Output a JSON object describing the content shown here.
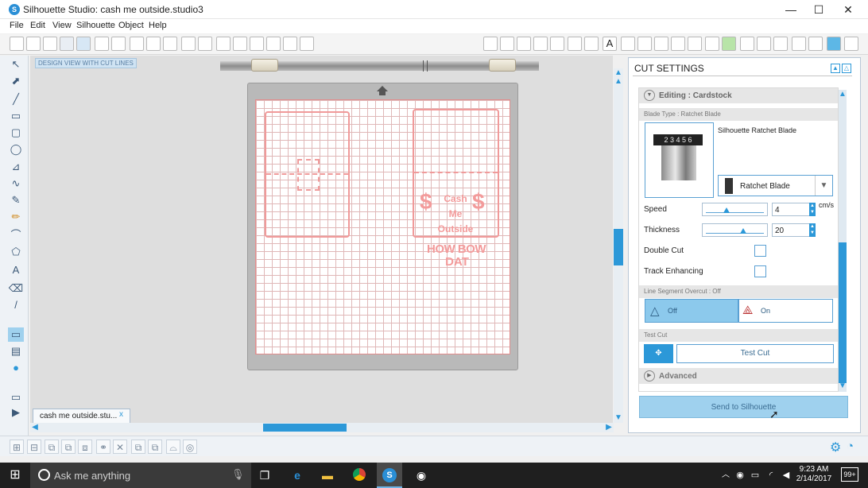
{
  "window": {
    "title": "Silhouette Studio: cash me outside.studio3",
    "app_icon": "S",
    "minimize": "—",
    "maximize": "☐",
    "close": "✕"
  },
  "menu": [
    "File",
    "Edit",
    "View",
    "Silhouette",
    "Object",
    "Help"
  ],
  "design": {
    "view_label": "DESIGN VIEW WITH CUT LINES",
    "artwork_text": {
      "line1": "Cash",
      "line2": "Me",
      "line3": "Outside",
      "dollar": "$",
      "how_bow": "HOW BOW",
      "dat": "DAT"
    },
    "doc_tab": "cash me outside.stu...",
    "doc_tab_close": "x"
  },
  "cut_settings": {
    "title": "CUT SETTINGS",
    "editing": "Editing : Cardstock",
    "blade_type_header": "Blade Type : Ratchet Blade",
    "blade_name": "Silhouette Ratchet Blade",
    "blade_select": "Ratchet Blade",
    "blade_dial_text": "2 3 4 5 6",
    "speed_label": "Speed",
    "speed_value": "4",
    "speed_unit": "cm/s",
    "thickness_label": "Thickness",
    "thickness_value": "20",
    "double_cut_label": "Double Cut",
    "track_enhancing_label": "Track Enhancing",
    "line_overcut_header": "Line Segment Overcut : Off",
    "off_label": "Off",
    "on_label": "On",
    "test_cut_header": "Test Cut",
    "test_cut_button": "Test Cut",
    "advanced_label": "Advanced",
    "send_button": "Send to Silhouette",
    "speed_fraction": 0.35,
    "thickness_fraction": 0.63
  },
  "taskbar": {
    "search_placeholder": "Ask me anything",
    "time": "9:23 AM",
    "date": "2/14/2017",
    "notification_count": "99+"
  },
  "colors": {
    "accent": "#2c98d8",
    "cut_line": "#f09a9a"
  }
}
